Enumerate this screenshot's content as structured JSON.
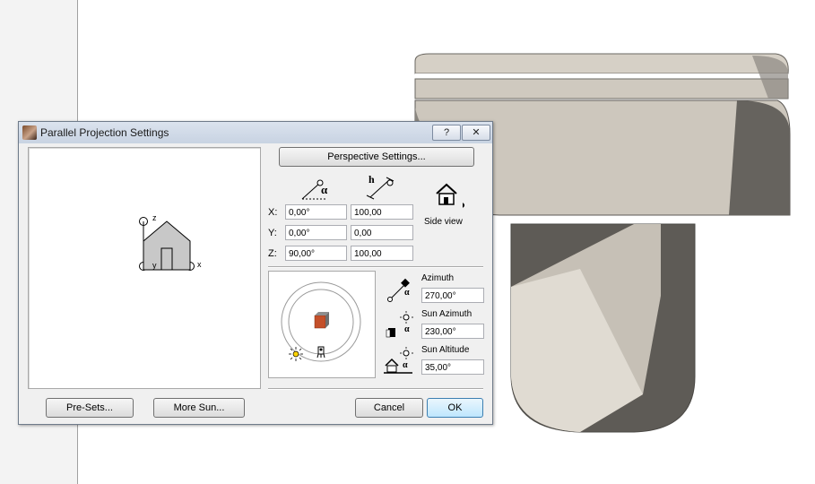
{
  "dialog": {
    "title": "Parallel Projection Settings",
    "help_label": "?",
    "close_label": "✕"
  },
  "preview": {
    "z_label": "z",
    "y_label": "y",
    "x_label": "x"
  },
  "buttons": {
    "perspective_settings": "Perspective Settings...",
    "presets": "Pre-Sets...",
    "more_sun": "More Sun...",
    "cancel": "Cancel",
    "ok": "OK"
  },
  "columns": {
    "height_symbol": "h",
    "angle_symbol": "α"
  },
  "view": {
    "label": "Side view"
  },
  "coords": [
    {
      "axis": "X:",
      "angle": "0,00°",
      "value": "100,00"
    },
    {
      "axis": "Y:",
      "angle": "0,00°",
      "value": "0,00"
    },
    {
      "axis": "Z:",
      "angle": "90,00°",
      "value": "100,00"
    }
  ],
  "sun": {
    "azimuth_label": "Azimuth",
    "azimuth_value": "270,00°",
    "sun_azimuth_label": "Sun Azimuth",
    "sun_azimuth_value": "230,00°",
    "sun_altitude_label": "Sun Altitude",
    "sun_altitude_value": "35,00°"
  },
  "colors": {
    "model_light": "#d2ccc2",
    "model_shade": "#8e8a83",
    "model_dark": "#5e5b56",
    "box_orange": "#c4502a",
    "ok_blue": "#3c7fb1"
  }
}
